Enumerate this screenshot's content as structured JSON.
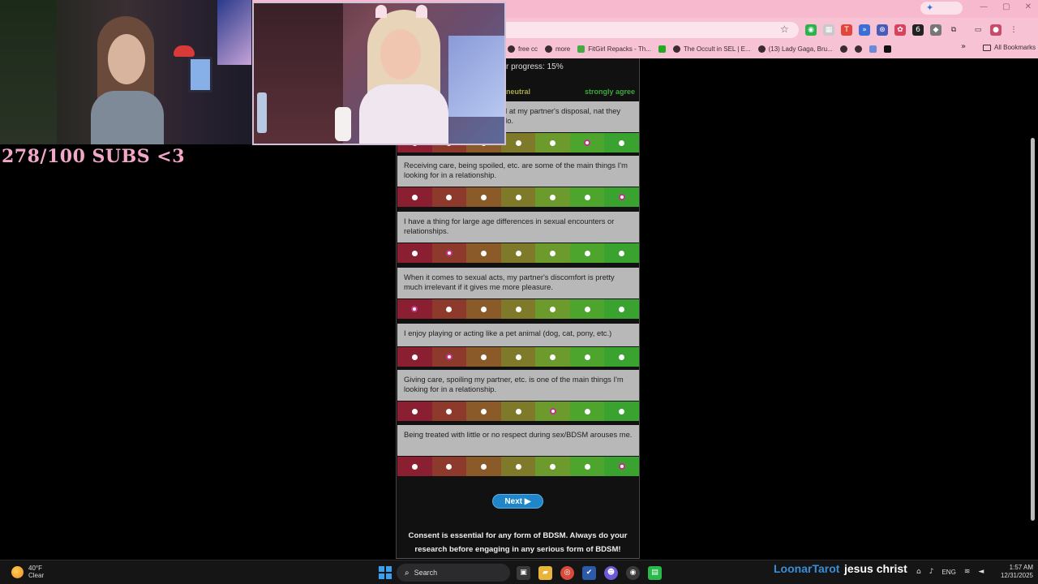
{
  "browser": {
    "gemini_icon": "sparkle-icon",
    "window_controls": [
      "—",
      "▢",
      "✕"
    ],
    "bookmarks": [
      {
        "label": "free cc",
        "icon": "globe-icon"
      },
      {
        "label": "more",
        "icon": "globe-icon"
      },
      {
        "label": "FitGirl Repacks - Th...",
        "icon": "fitgirl-icon"
      },
      {
        "label": "The Occult in SEL | E...",
        "icon": "globe-icon"
      },
      {
        "label": "(13) Lady Gaga, Bru...",
        "icon": "globe-icon"
      }
    ],
    "all_bookmarks": "All Bookmarks",
    "overflow": "»"
  },
  "quiz": {
    "progress": "r progress: 15%",
    "scale_left": "neutral",
    "scale_right": "strongly agree",
    "accent_selected": "#c2338a",
    "questions": [
      {
        "text": "d at my partner's disposal, nat they do.",
        "selected": 5
      },
      {
        "text": "Receiving care, being spoiled, etc. are some of the main things I'm looking for in a relationship.",
        "selected": 6
      },
      {
        "text": "I have a thing for large age differences in sexual encounters or relationships.",
        "selected": 1
      },
      {
        "text": "When it comes to sexual acts, my partner's discomfort is pretty much irrelevant if it gives me more pleasure.",
        "selected": 0
      },
      {
        "text": "I enjoy playing or acting like a pet animal (dog, cat, pony, etc.)",
        "selected": 1
      },
      {
        "text": "Giving care, spoiling my partner, etc. is one of the main things I'm looking for in a relationship.",
        "selected": 4
      },
      {
        "text": "Being treated with little or no respect during sex/BDSM arouses me.",
        "selected": 6
      }
    ],
    "next_label": "Next ▶",
    "consent_line1": "Consent is essential for any form of BDSM. Always do your",
    "consent_line2": "research before engaging in any serious form of BDSM!"
  },
  "stream": {
    "subs_goal": "278/100 SUBS <3",
    "chat_user": "LoonarTarot",
    "chat_message": "jesus christ"
  },
  "taskbar": {
    "temperature": "40°F",
    "condition": "Clear",
    "search_label": "Search",
    "language": "ENG",
    "time": "1:57 AM",
    "date": "12/31/2025"
  }
}
